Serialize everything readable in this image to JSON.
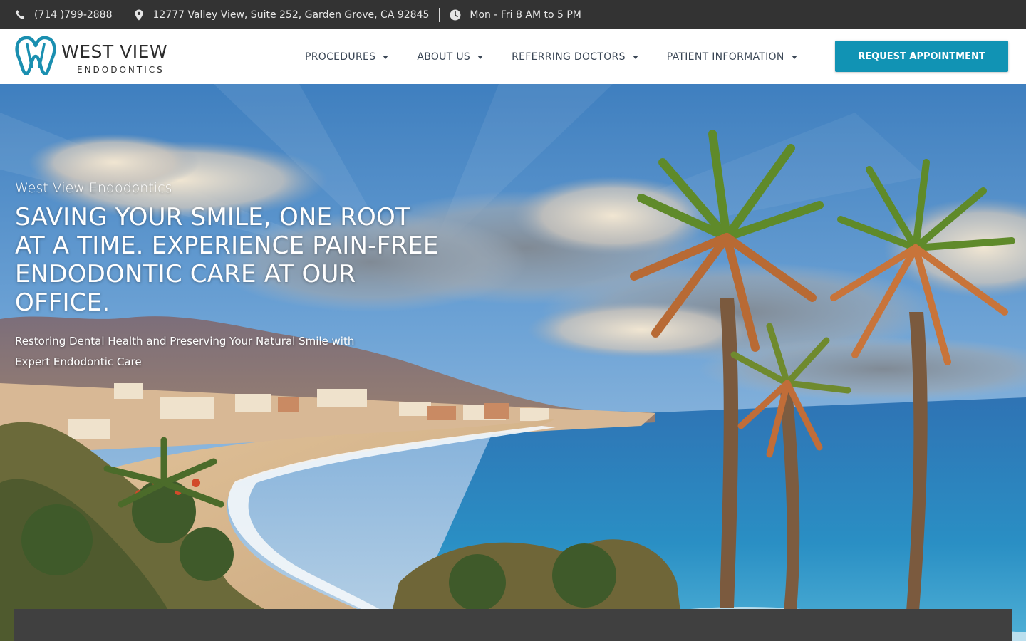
{
  "topbar": {
    "phone": "(714 )799-2888",
    "address": "12777 Valley View, Suite 252, Garden Grove, CA 92845",
    "hours": "Mon - Fri 8 AM to 5 PM",
    "icons": [
      "phone-icon",
      "map-pin-icon",
      "clock-icon"
    ]
  },
  "logo": {
    "name": "WEST VIEW",
    "subtitle": "ENDODONTICS",
    "color": "#1a8fb0"
  },
  "nav": {
    "items": [
      {
        "label": "PROCEDURES"
      },
      {
        "label": "ABOUT US"
      },
      {
        "label": "REFERRING DOCTORS"
      },
      {
        "label": "PATIENT INFORMATION"
      }
    ],
    "cta_label": "REQUEST APPOINTMENT"
  },
  "hero": {
    "eyebrow": "West View Endodontics",
    "title": "SAVING YOUR SMILE, ONE ROOT AT A TIME. EXPERIENCE PAIN-FREE ENDODONTIC CARE AT OUR OFFICE.",
    "subtitle": "Restoring Dental Health and Preserving Your Natural Smile with Expert Endodontic Care"
  },
  "colors": {
    "topbar_bg": "#333333",
    "accent": "#1193b4",
    "nav_text": "#3a4655",
    "panel_bg": "#404040"
  }
}
